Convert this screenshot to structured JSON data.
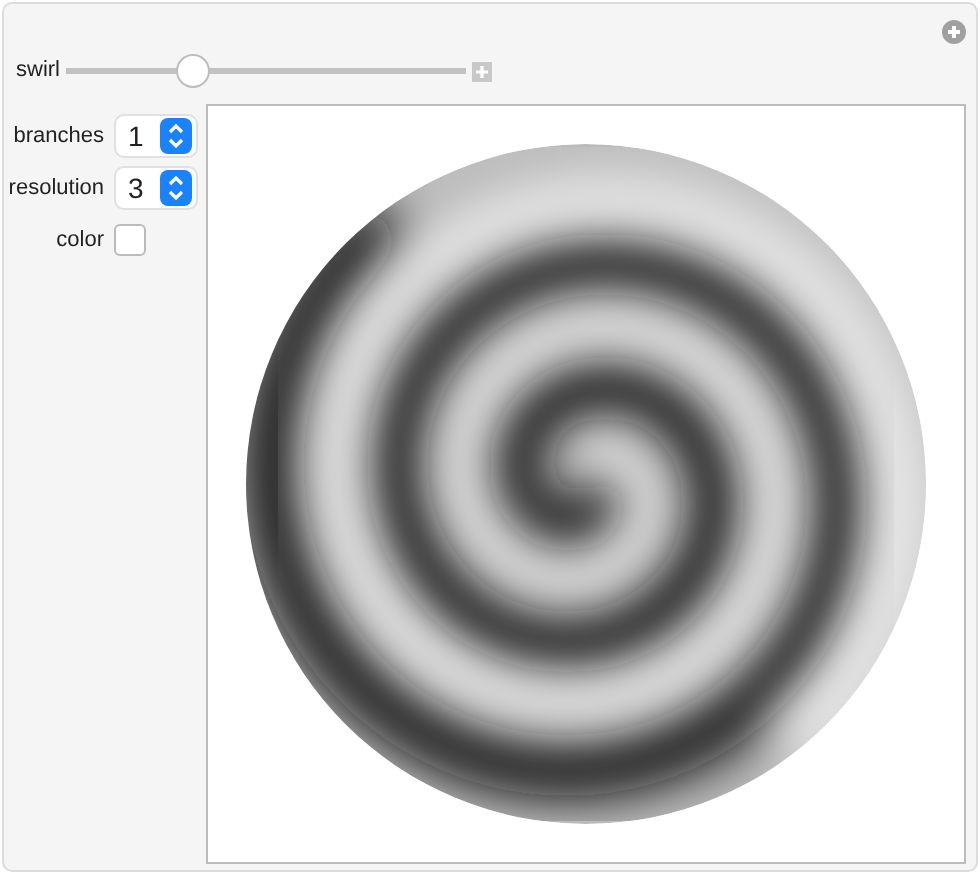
{
  "swirl": {
    "label": "swirl",
    "level": 0.32
  },
  "controls": [
    {
      "kind": "menu",
      "label": "branches",
      "value": "1"
    },
    {
      "kind": "menu",
      "label": "resolution",
      "value": "3"
    },
    {
      "kind": "checkbox",
      "label": "color",
      "checked": false
    }
  ]
}
